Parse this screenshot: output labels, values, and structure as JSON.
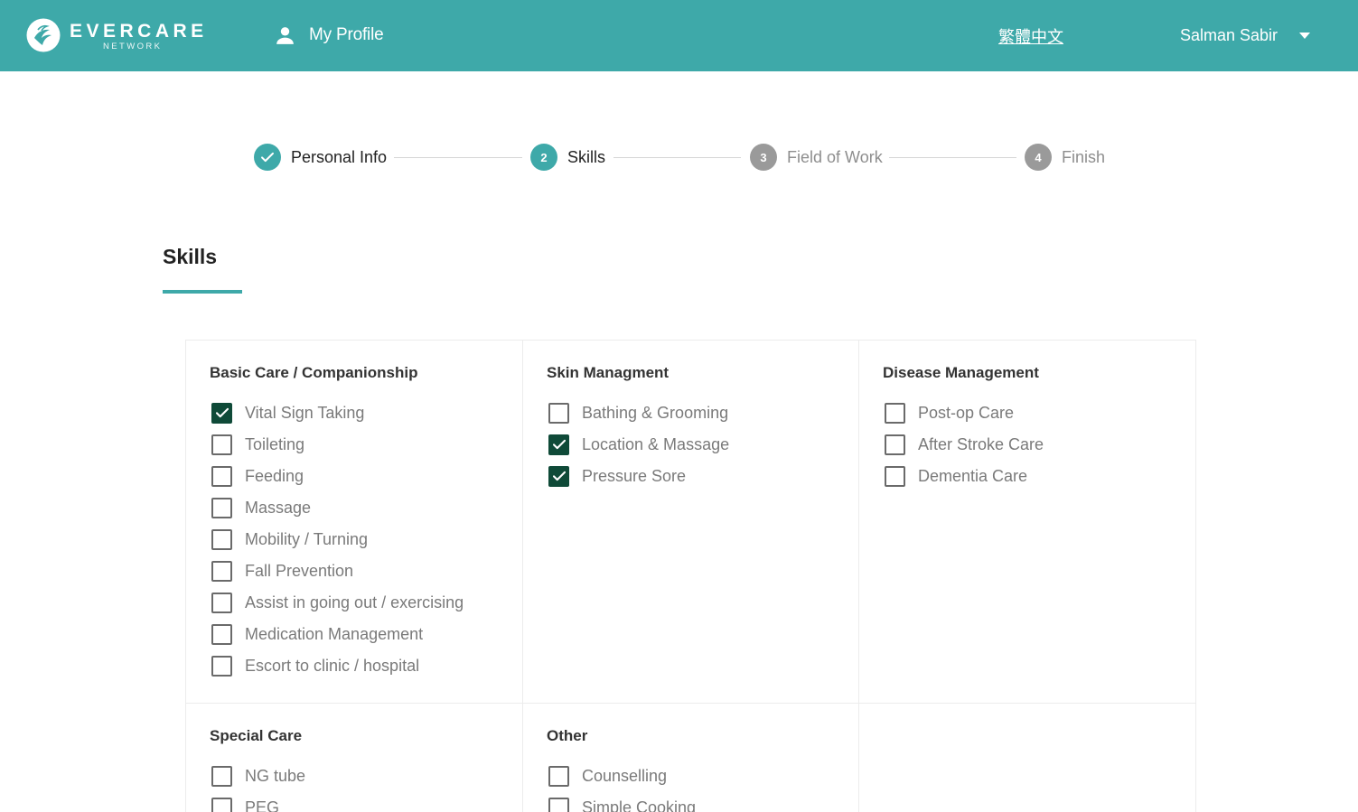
{
  "header": {
    "brand": "EVERCARE",
    "brand_sub": "NETWORK",
    "profile_label": "My Profile",
    "language_link": "繁體中文",
    "user_name": "Salman Sabir"
  },
  "stepper": {
    "steps": [
      {
        "number": "",
        "label": "Personal Info",
        "state": "done"
      },
      {
        "number": "2",
        "label": "Skills",
        "state": "active"
      },
      {
        "number": "3",
        "label": "Field of Work",
        "state": "pending"
      },
      {
        "number": "4",
        "label": "Finish",
        "state": "pending"
      }
    ]
  },
  "section": {
    "title": "Skills"
  },
  "skill_groups": [
    {
      "title": "Basic Care / Companionship",
      "options": [
        {
          "label": "Vital Sign Taking",
          "checked": true
        },
        {
          "label": "Toileting",
          "checked": false
        },
        {
          "label": "Feeding",
          "checked": false
        },
        {
          "label": "Massage",
          "checked": false
        },
        {
          "label": "Mobility / Turning",
          "checked": false
        },
        {
          "label": "Fall Prevention",
          "checked": false
        },
        {
          "label": "Assist in going out / exercising",
          "checked": false
        },
        {
          "label": "Medication Management",
          "checked": false
        },
        {
          "label": "Escort to clinic / hospital",
          "checked": false
        }
      ]
    },
    {
      "title": "Skin Managment",
      "options": [
        {
          "label": "Bathing & Grooming",
          "checked": false
        },
        {
          "label": "Location & Massage",
          "checked": true
        },
        {
          "label": "Pressure Sore",
          "checked": true
        }
      ]
    },
    {
      "title": "Disease Management",
      "options": [
        {
          "label": "Post-op Care",
          "checked": false
        },
        {
          "label": "After Stroke Care",
          "checked": false
        },
        {
          "label": "Dementia Care",
          "checked": false
        }
      ]
    },
    {
      "title": "Special Care",
      "options": [
        {
          "label": "NG tube",
          "checked": false
        },
        {
          "label": "PEG",
          "checked": false
        }
      ]
    },
    {
      "title": "Other",
      "options": [
        {
          "label": "Counselling",
          "checked": false
        },
        {
          "label": "Simple Cooking",
          "checked": false
        }
      ]
    }
  ],
  "colors": {
    "brand_teal": "#3ea9a9",
    "checkbox_checked": "#0f4a38",
    "step_pending": "#9a9a9a"
  }
}
